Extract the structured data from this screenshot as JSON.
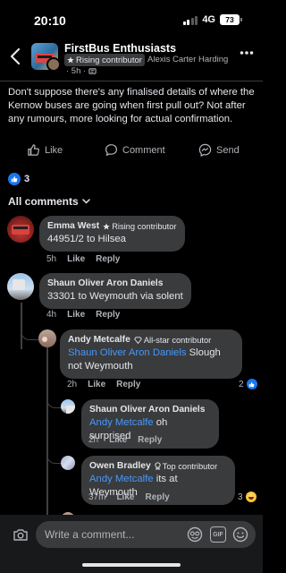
{
  "status": {
    "time": "20:10",
    "network": "4G",
    "battery": "73"
  },
  "header": {
    "group_name": "FirstBus Enthusiasts",
    "badge": "Rising contributor",
    "author": "Alexis Carter Harding",
    "meta": "· 5h ·"
  },
  "post": {
    "text": "Don't suppose there's any finalised details of where the Kernow buses are going when first pull out? Not after any rumours, more looking for actual confirmation."
  },
  "actions": {
    "like": "Like",
    "comment": "Comment",
    "send": "Send"
  },
  "reactions": {
    "count": "3"
  },
  "filter": {
    "label": "All comments"
  },
  "comments": [
    {
      "name": "Emma West",
      "badge": "Rising contributor",
      "text": "44951/2 to Hilsea",
      "time": "5h",
      "like": "Like",
      "reply": "Reply"
    },
    {
      "name": "Shaun Oliver Aron Daniels",
      "text": "33301 to Weymouth via solent",
      "time": "4h",
      "like": "Like",
      "reply": "Reply"
    },
    {
      "name": "Andy Metcalfe",
      "badge": "All-star contributor",
      "mention": "Shaun Oliver Aron Daniels",
      "text": " Slough not Weymouth",
      "time": "2h",
      "like": "Like",
      "reply": "Reply",
      "reaction_count": "2"
    },
    {
      "name": "Shaun Oliver Aron Daniels",
      "mention": "Andy Metcalfe",
      "text": " oh surprised",
      "time": "2h",
      "like": "Like",
      "reply": "Reply"
    },
    {
      "name": "Owen Bradley",
      "badge": "Top contributor",
      "mention": "Andy Metcalfe",
      "text": " its at Weymouth",
      "time": "37m",
      "like": "Like",
      "reply": "Reply",
      "reaction_count": "3"
    }
  ],
  "composer": {
    "placeholder": "Write a comment...",
    "gif": "GIF"
  },
  "colors": {
    "background": "#000000",
    "bubble": "#3a3b3c",
    "mention": "#4599ff",
    "like_blue": "#1877f2"
  }
}
